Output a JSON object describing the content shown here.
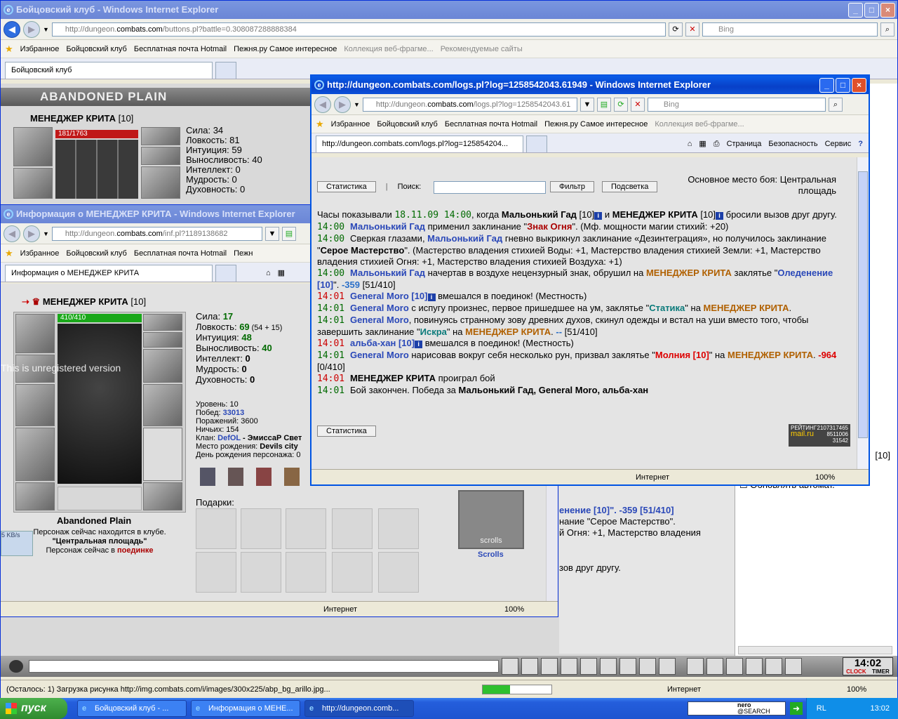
{
  "main_window": {
    "title": "Бойцовский клуб - Windows Internet Explorer",
    "url_prefix": "http://dungeon.",
    "url_domain": "combats.com",
    "url_suffix": "/buttons.pl?battle=0.308087288888384",
    "search_placeholder": "Bing",
    "favorites_label": "Избранное",
    "favorites": [
      "Бойцовский клуб",
      "Бесплатная почта Hotmail",
      "Пежня.ру Самое интересное",
      "Коллекция веб-фрагме...",
      "Рекомендуемые сайты"
    ],
    "tab_label": "Бойцовский клуб",
    "tools": [
      "Страница",
      "Безопасность",
      "Сервис"
    ],
    "location_banner": "ABANDONED PLAIN",
    "char_name": "МЕНЕДЖЕР КРИТА",
    "char_level": "[10]",
    "hp": "181/1763",
    "stats": [
      "Сила: 34",
      "Ловкость: 81",
      "Интуиция: 59",
      "Выносливость: 40",
      "Интеллект: 0",
      "Мудрость: 0",
      "Духовность: 0"
    ],
    "right_log": [
      "енение [10]\". -359 [51/410]",
      "нание \"Серое Мастерство\".",
      "й Огня: +1, Мастерство владения",
      "зов друг другу."
    ],
    "right_level": "[10]",
    "auto_refresh": "Обновлять автомат.",
    "chat_clock": "14:02",
    "clock_label": "CLOCK",
    "timer_label": "TIMER",
    "status_text": "(Осталось: 1) Загрузка рисунка http://img.combats.com/i/images/300x225/abp_bg_arillo.jpg...",
    "status_zone": "Интернет",
    "zoom": "100%"
  },
  "info_window": {
    "title": "Информация о МЕНЕДЖЕР КРИТА - Windows Internet Explorer",
    "url_prefix": "http://dungeon.",
    "url_domain": "combats.com",
    "url_suffix": "/inf.pl?1189138682",
    "favorites_label": "Избранное",
    "favorites": [
      "Бойцовский клуб",
      "Бесплатная почта Hotmail",
      "Пежн"
    ],
    "tab_label": "Информация о МЕНЕДЖЕР КРИТА",
    "char_name": "МЕНЕДЖЕР КРИТА",
    "char_level": "[10]",
    "hp": "410/410",
    "watermark": "This is unregistered version",
    "net_speed": "5 KB/s",
    "stats": [
      {
        "label": "Сила: ",
        "value": "17",
        "extra": ""
      },
      {
        "label": "Ловкость: ",
        "value": "69",
        "extra": " (54 + 15)"
      },
      {
        "label": "Интуиция: ",
        "value": "48",
        "extra": ""
      },
      {
        "label": "Выносливость: ",
        "value": "40",
        "extra": ""
      },
      {
        "label": "Интеллект: ",
        "value": "0",
        "extra": ""
      },
      {
        "label": "Мудрость: ",
        "value": "0",
        "extra": ""
      },
      {
        "label": "Духовность: ",
        "value": "0",
        "extra": ""
      }
    ],
    "level_line": "Уровень: 10",
    "wins_label": "Побед: ",
    "wins": "33013",
    "losses_line": "Поражений: 3600",
    "draws_line": "Ничьих: 154",
    "clan_label": "Клан: ",
    "clan": "DefOL",
    "clan_rest": " - ЭмиссаР Свет",
    "birthplace_label": "Место рождения: ",
    "birthplace": "Devils city",
    "birthday_line": "День рождения персонажа: 0",
    "gifts_label": "Подарки:",
    "location": "Abandoned Plain",
    "presence_line": "Персонаж сейчас находится в клубе.",
    "room": "\"Центральная площадь\"",
    "battle_prefix": "Персонаж сейчас в ",
    "battle_word": "поединке",
    "scrolls_label": "Scrolls",
    "scrolls_emblem": "scrolls",
    "status_zone": "Интернет",
    "zoom": "100%"
  },
  "log_window": {
    "title": "http://dungeon.combats.com/logs.pl?log=1258542043.61949 - Windows Internet Explorer",
    "url_prefix": "http://dungeon.",
    "url_domain": "combats.com",
    "url_suffix": "/logs.pl?log=1258542043.61",
    "search_placeholder": "Bing",
    "favorites_label": "Избранное",
    "favorites": [
      "Бойцовский клуб",
      "Бесплатная почта Hotmail",
      "Пежня.ру Самое интересное",
      "Коллекция веб-фрагме..."
    ],
    "tab_label": "http://dungeon.combats.com/logs.pl?log=125854204...",
    "tools": [
      "Страница",
      "Безопасность",
      "Сервис"
    ],
    "btn_stats": "Статистика",
    "search_label": "Поиск:",
    "btn_filter": "Фильтр",
    "btn_highlight": "Подсветка",
    "place_line1": "Основное место боя: Центральная",
    "place_line2": "площадь",
    "rating_label": "РЕЙТИНГ",
    "rating_numbers": [
      "2107317465",
      "8511006",
      "31542"
    ],
    "rating_brand": "mail.ru",
    "status_zone": "Интернет",
    "zoom": "100%",
    "log": [
      [
        [
          "Часы показывали ",
          ""
        ],
        [
          "18.11.09 14:00",
          "green mono"
        ],
        [
          ", когда ",
          ""
        ],
        [
          "Мальонький Гад",
          "b"
        ],
        [
          " [10]",
          ""
        ],
        [
          "i",
          "info"
        ],
        [
          " и ",
          ""
        ],
        [
          "МЕНЕДЖЕР КРИТА",
          "b"
        ],
        [
          " [10]",
          ""
        ],
        [
          "i",
          "info"
        ],
        [
          " бросили вызов друг другу.",
          ""
        ]
      ],
      [
        [
          "14:00 ",
          "green mono"
        ],
        [
          "Мальонький Гад",
          "blue"
        ],
        [
          " применил заклинание \"",
          ""
        ],
        [
          "Знак Огня",
          "darkred"
        ],
        [
          "\". (Мф. мощности магии стихий: +20)",
          ""
        ]
      ],
      [
        [
          "14:00 ",
          "green mono"
        ],
        [
          "Сверкая глазами, ",
          ""
        ],
        [
          "Мальонький Гад",
          "blue"
        ],
        [
          " гневно выкрикнул заклинание «Дезинтеграция», но получилось заклинание \"",
          ""
        ],
        [
          "Серое Мастерство",
          "b"
        ],
        [
          "\". (Мастерство владения стихией Воды: +1, Мастерство владения стихией Земли: +1, Мастерство владения стихией Огня: +1, Мастерство владения стихией Воздуха: +1)",
          ""
        ]
      ],
      [
        [
          "14:00 ",
          "green mono"
        ],
        [
          "Мальонький Гад",
          "blue"
        ],
        [
          " начертав в воздухе нецензурный знак, обрушил на ",
          ""
        ],
        [
          "МЕНЕДЖЕР КРИТА",
          "orange"
        ],
        [
          " заклятье \"",
          ""
        ],
        [
          "Оледенение [10]",
          "blue"
        ],
        [
          "\". ",
          ""
        ],
        [
          "-359",
          "num"
        ],
        [
          " [51/410]",
          ""
        ]
      ],
      [
        [
          "14:01 ",
          "red mono"
        ],
        [
          "General Moro [10]",
          "blue"
        ],
        [
          "i",
          "info"
        ],
        [
          " вмешался в поединок! (Местность)",
          ""
        ]
      ],
      [
        [
          "14:01 ",
          "green mono"
        ],
        [
          "General Moro",
          "blue"
        ],
        [
          " с испугу произнес, первое пришедшее на ум, заклятье \"",
          ""
        ],
        [
          "Статика",
          "teal"
        ],
        [
          "\" на ",
          ""
        ],
        [
          "МЕНЕДЖЕР КРИТА",
          "orange"
        ],
        [
          ".",
          ""
        ]
      ],
      [
        [
          "14:01 ",
          "green mono"
        ],
        [
          "General Moro",
          "blue"
        ],
        [
          ", повинуясь странному зову древних духов, скинул одежды и встал на уши вместо того, чтобы завершить заклинание \"",
          ""
        ],
        [
          "Искра",
          "teal"
        ],
        [
          "\" на ",
          ""
        ],
        [
          "МЕНЕДЖЕР КРИТА",
          "orange"
        ],
        [
          ". ",
          ""
        ],
        [
          "--",
          "num"
        ],
        [
          " [51/410]",
          ""
        ]
      ],
      [
        [
          "14:01 ",
          "red mono"
        ],
        [
          "альба-хан [10]",
          "blue"
        ],
        [
          "i",
          "info"
        ],
        [
          " вмешался в поединок! (Местность)",
          ""
        ]
      ],
      [
        [
          "14:01 ",
          "green mono"
        ],
        [
          "General Moro",
          "blue"
        ],
        [
          " нарисовав вокруг себя несколько рун, призвал заклятье \"",
          ""
        ],
        [
          "Молния [10]",
          "redb"
        ],
        [
          "\" на ",
          ""
        ],
        [
          "МЕНЕДЖЕР КРИТА",
          "orange"
        ],
        [
          ". ",
          ""
        ],
        [
          "-964",
          "redb"
        ],
        [
          " [0/410]",
          ""
        ]
      ],
      [
        [
          "14:01 ",
          "red mono"
        ],
        [
          "МЕНЕДЖЕР КРИТА",
          "b"
        ],
        [
          " проиграл бой",
          ""
        ]
      ],
      [
        [
          "14:01 ",
          "green mono"
        ],
        [
          "Бой закончен. Победа за ",
          ""
        ],
        [
          "Мальонький Гад, General Moro, альба-хан",
          "b"
        ]
      ]
    ]
  },
  "taskbar": {
    "start_label": "пуск",
    "tasks": [
      "Бойцовский клуб - ...",
      "Информация о МЕНЕ...",
      "http://dungeon.comb..."
    ],
    "search_brand": "nero",
    "search_brand_sub": "@SEARCH",
    "lang": "RL",
    "time": "13:02"
  }
}
